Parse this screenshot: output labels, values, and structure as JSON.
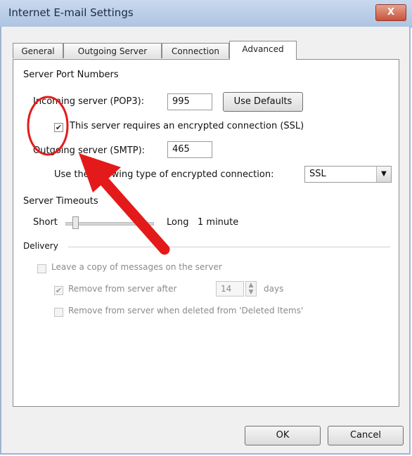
{
  "window": {
    "title": "Internet E-mail Settings",
    "close_label": "X"
  },
  "tabs": [
    {
      "label": "General"
    },
    {
      "label": "Outgoing Server"
    },
    {
      "label": "Connection"
    },
    {
      "label": "Advanced"
    }
  ],
  "ports": {
    "section_label": "Server Port Numbers",
    "incoming_label": "Incoming server (POP3):",
    "incoming_value": "995",
    "use_defaults_label": "Use Defaults",
    "ssl_checkbox_label": "This server requires an encrypted connection (SSL)",
    "ssl_checked": true,
    "outgoing_label": "Outgoing server (SMTP):",
    "outgoing_value": "465",
    "encryption_label": "Use the following type of encrypted connection:",
    "encryption_value": "SSL"
  },
  "timeouts": {
    "section_label": "Server Timeouts",
    "short_label": "Short",
    "long_label": "Long",
    "value_label": "1 minute"
  },
  "delivery": {
    "section_label": "Delivery",
    "leave_copy_label": "Leave a copy of messages on the server",
    "remove_after_label": "Remove from server after",
    "remove_after_value": "14",
    "days_label": "days",
    "remove_deleted_label": "Remove from server when deleted from 'Deleted Items'"
  },
  "footer": {
    "ok_label": "OK",
    "cancel_label": "Cancel"
  },
  "colors": {
    "annotation": "#e41a1a"
  }
}
